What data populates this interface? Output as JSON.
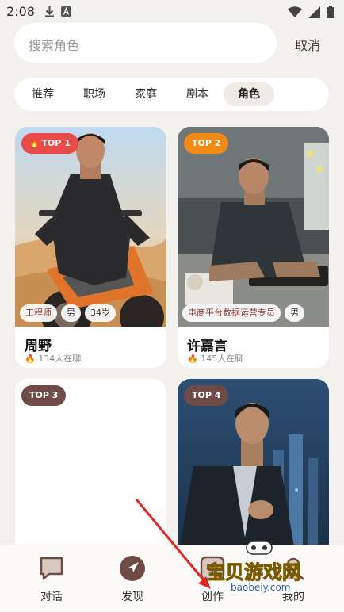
{
  "status": {
    "time": "2:08"
  },
  "search": {
    "placeholder": "搜索角色",
    "cancel_label": "取消"
  },
  "tabs": [
    {
      "label": "推荐",
      "active": false
    },
    {
      "label": "职场",
      "active": false
    },
    {
      "label": "家庭",
      "active": false
    },
    {
      "label": "剧本",
      "active": false
    },
    {
      "label": "角色",
      "active": true
    }
  ],
  "cards": [
    {
      "rank": "TOP 1",
      "rank_color": "#e94a4a",
      "tags": [
        "工程师",
        "男",
        "34岁"
      ],
      "name": "周野",
      "chat_count": "134人在聊"
    },
    {
      "rank": "TOP 2",
      "rank_color": "#f08a16",
      "tags": [
        "电商平台数据运营专员",
        "男"
      ],
      "name": "许嘉言",
      "chat_count": "145人在聊"
    },
    {
      "rank": "TOP 3",
      "rank_color": "#6e4b47"
    },
    {
      "rank": "TOP 4",
      "rank_color": "#6e4b47"
    }
  ],
  "nav": [
    {
      "label": "对话",
      "icon": "chat-bubble-icon"
    },
    {
      "label": "发现",
      "icon": "compass-icon"
    },
    {
      "label": "创作",
      "icon": "create-icon"
    },
    {
      "label": "我的",
      "icon": "profile-icon"
    }
  ],
  "watermark": {
    "title": "宝贝游戏网",
    "url": "baobeiy.com"
  },
  "colors": {
    "background": "#f3f1ee",
    "accent": "#6e4b47"
  }
}
